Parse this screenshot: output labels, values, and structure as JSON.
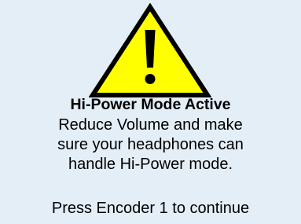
{
  "dialog": {
    "icon": "warning-triangle-icon",
    "colors": {
      "background": "#e4eef7",
      "triangle_fill": "#ffff00",
      "triangle_stroke": "#000000"
    },
    "title": "Hi-Power Mode Active",
    "message_lines": [
      "Reduce Volume and make",
      "sure your headphones can",
      "handle Hi-Power mode."
    ],
    "prompt": "Press Encoder 1 to continue"
  }
}
